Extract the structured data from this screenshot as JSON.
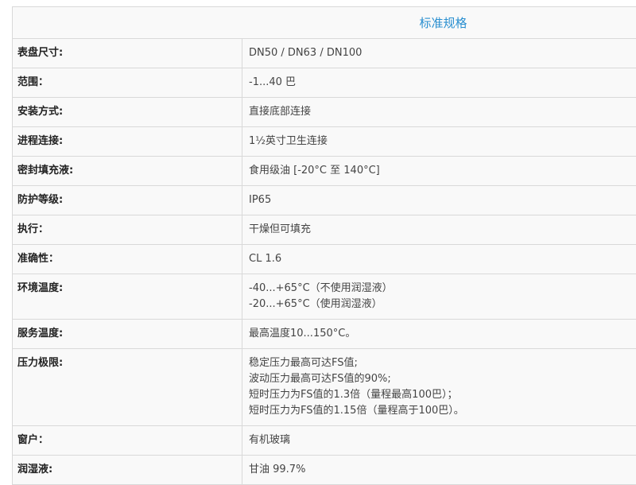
{
  "header": {
    "title": "标准规格"
  },
  "rows": [
    {
      "label": "表盘尺寸:",
      "lines": [
        "DN50 / DN63 / DN100"
      ]
    },
    {
      "label": "范围：",
      "lines": [
        "-1...40 巴"
      ]
    },
    {
      "label": "安装方式:",
      "lines": [
        "直接底部连接"
      ]
    },
    {
      "label": "进程连接:",
      "lines": [
        "1½英寸卫生连接"
      ]
    },
    {
      "label": "密封填充液:",
      "lines": [
        "食用级油 [-20°C 至 140°C]"
      ]
    },
    {
      "label": "防护等级:",
      "lines": [
        "IP65"
      ]
    },
    {
      "label": "执行：",
      "lines": [
        "干燥但可填充"
      ]
    },
    {
      "label": "准确性：",
      "lines": [
        "CL 1.6"
      ]
    },
    {
      "label": "环境温度:",
      "lines": [
        "-40...+65°C（不使用润湿液）",
        "-20...+65°C（使用润湿液）"
      ]
    },
    {
      "label": "服务温度:",
      "lines": [
        "最高温度10...150°C。"
      ]
    },
    {
      "label": "压力极限:",
      "lines": [
        "稳定压力最高可达FS值;",
        "波动压力最高可达FS值的90%;",
        "短时压力为FS值的1.3倍（量程最高100巴）；",
        "短时压力为FS值的1.15倍（量程高于100巴）。"
      ]
    },
    {
      "label": "窗户：",
      "lines": [
        "有机玻璃"
      ]
    },
    {
      "label": "润湿液:",
      "lines": [
        "甘油 99.7%"
      ]
    }
  ]
}
